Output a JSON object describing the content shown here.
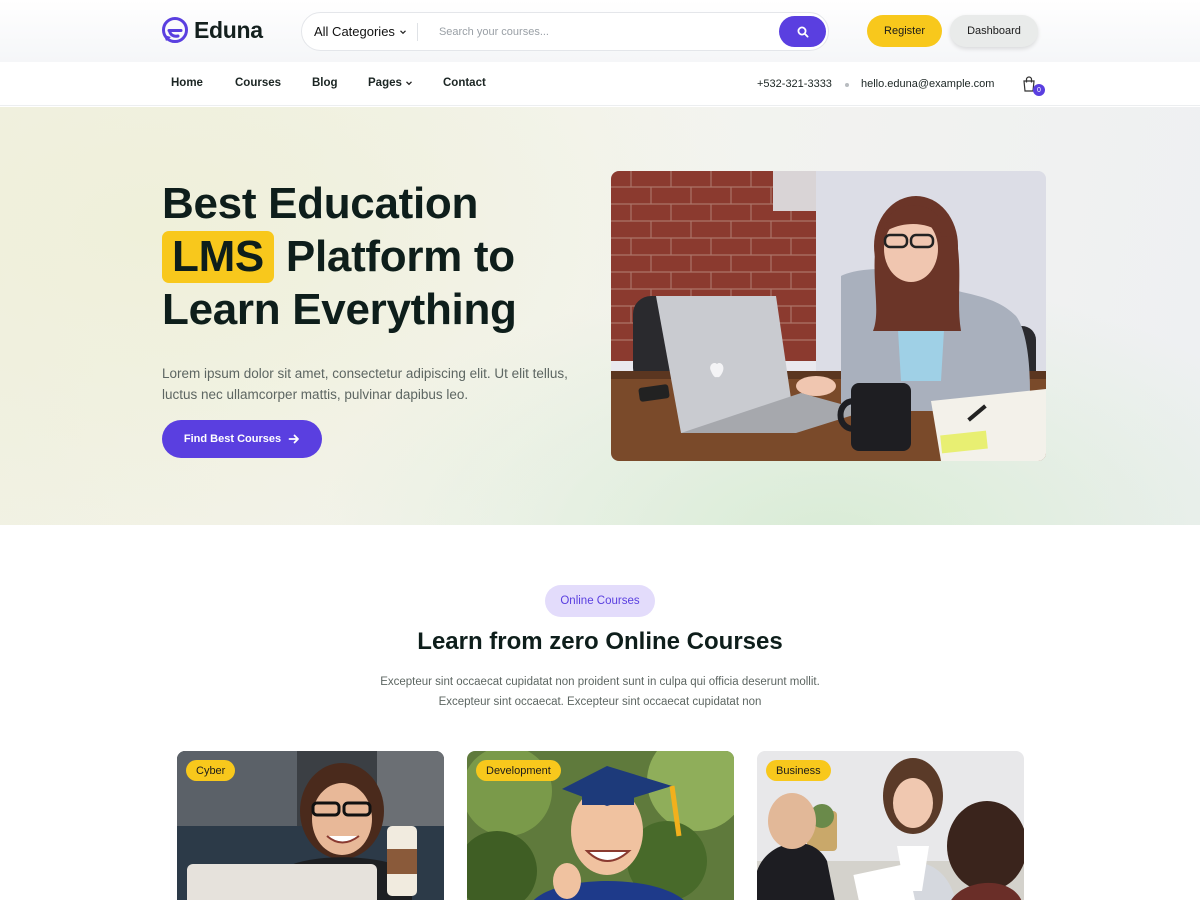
{
  "brand": {
    "name": "Eduna",
    "accent": "#5a3fe0",
    "highlight": "#f8c81c"
  },
  "search": {
    "category_label": "All Categories",
    "placeholder": "Search your courses...",
    "button_icon": "search-icon"
  },
  "header_buttons": {
    "register": "Register",
    "dashboard": "Dashboard"
  },
  "nav": {
    "items": [
      {
        "label": "Home"
      },
      {
        "label": "Courses"
      },
      {
        "label": "Blog"
      },
      {
        "label": "Pages"
      },
      {
        "label": "Contact"
      }
    ],
    "phone": "+532-321-3333",
    "email": "hello.eduna@example.com",
    "cart_count": "0"
  },
  "hero": {
    "title_line1": "Best Education",
    "title_highlight": "LMS",
    "title_line2_rest": "Platform to",
    "title_line3": "Learn Everything",
    "description": "Lorem ipsum dolor sit amet, consectetur adipiscing elit. Ut elit tellus, luctus nec ullamcorper mattis, pulvinar dapibus leo.",
    "button_label": "Find Best Courses"
  },
  "courses_section": {
    "pill": "Online Courses",
    "title": "Learn from zero Online Courses",
    "description_line1": "Excepteur sint occaecat cupidatat non proident sunt in culpa qui officia deserunt mollit.",
    "description_line2": "Excepteur sint occaecat. Excepteur sint occaecat cupidatat non",
    "cards": [
      {
        "tag": "Cyber"
      },
      {
        "tag": "Development"
      },
      {
        "tag": "Business"
      }
    ]
  }
}
